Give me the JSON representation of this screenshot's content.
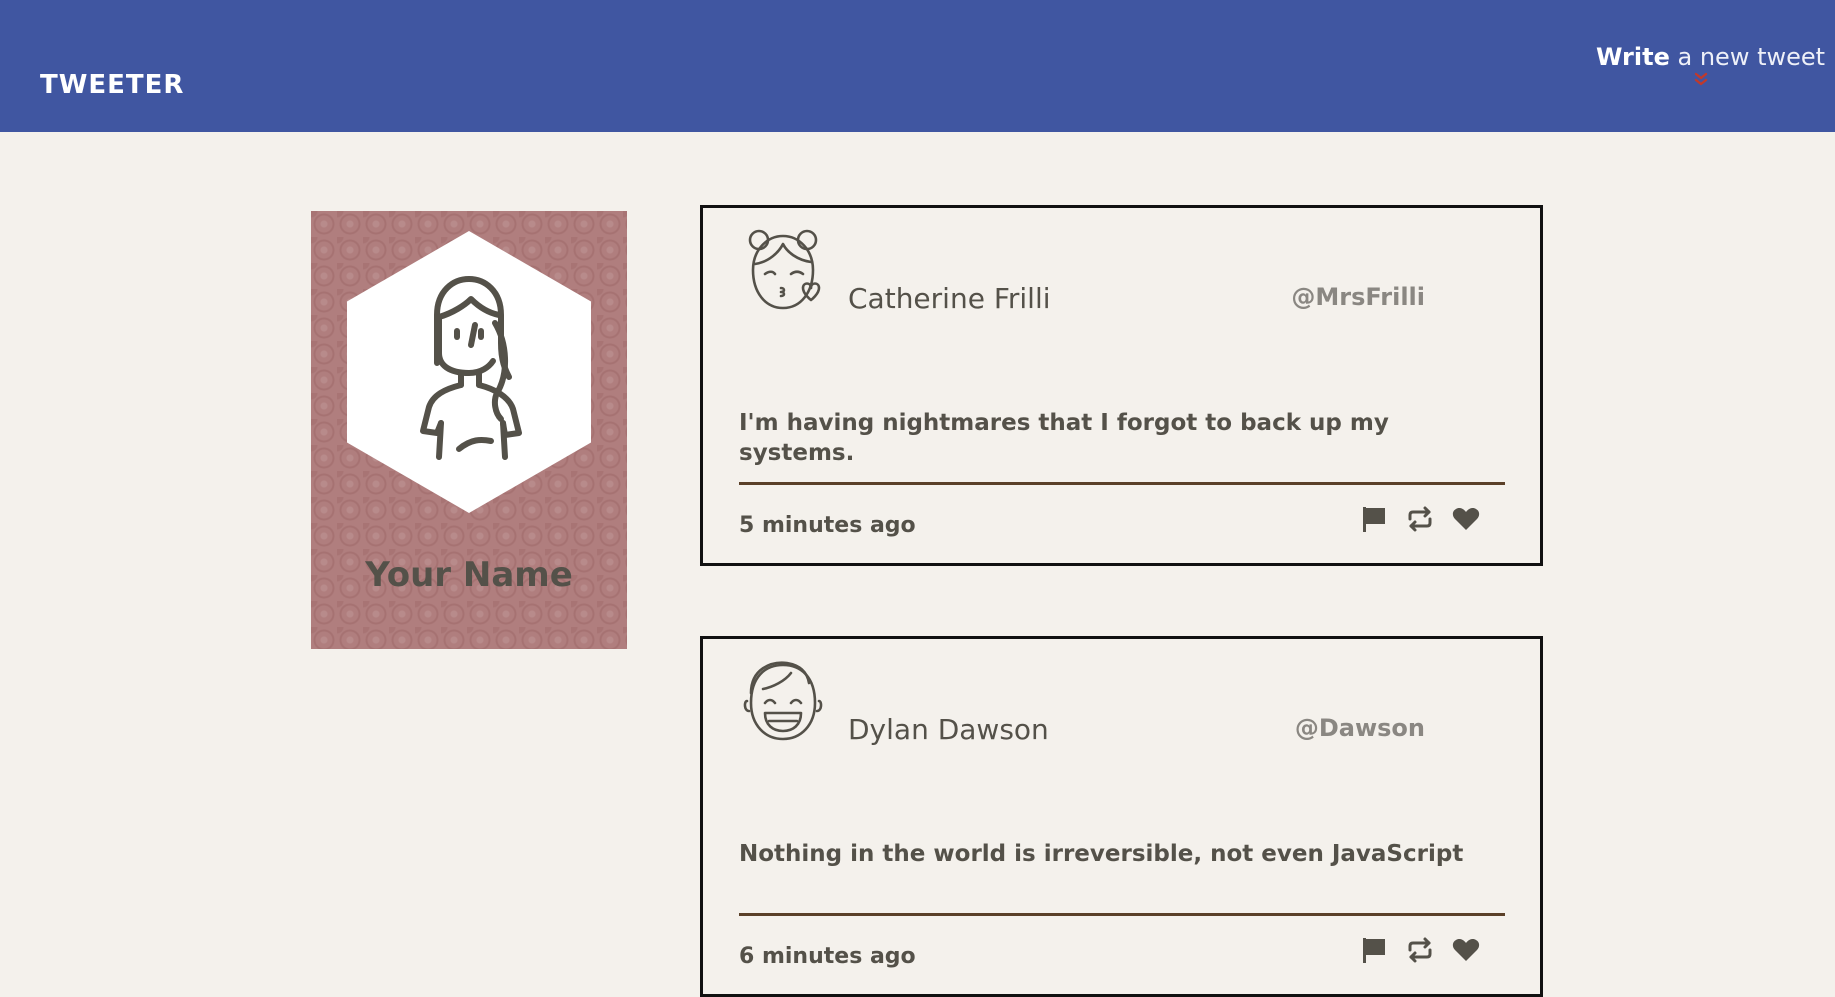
{
  "app": {
    "brand": "TWEETER"
  },
  "header": {
    "compose_strong": "Write",
    "compose_rest": " a new tweet",
    "compose_icon": "chevron-double-down-icon",
    "compose_icon_color": "#c0392b"
  },
  "profile": {
    "name": "Your Name",
    "avatar_icon": "user-woman-icon"
  },
  "tweets": [
    {
      "name": "Catherine Frilli",
      "handle": "@MrsFrilli",
      "text": "I'm having nightmares that I forgot to back up my systems.",
      "time": "5 minutes ago",
      "avatar_icon": "girl-kiss-avatar-icon"
    },
    {
      "name": "Dylan Dawson",
      "handle": "@Dawson",
      "text": "Nothing in the world is irreversible, not even JavaScript",
      "time": "6 minutes ago",
      "avatar_icon": "boy-laughing-avatar-icon"
    }
  ],
  "actions": [
    "flag-icon",
    "retweet-icon",
    "heart-icon"
  ],
  "colors": {
    "header_bg": "#4056a1",
    "page_bg": "#f4f1ec",
    "profile_bg": "#b07e7e",
    "text": "#545149",
    "handle": "#8a8782",
    "divider": "#5a4028"
  }
}
